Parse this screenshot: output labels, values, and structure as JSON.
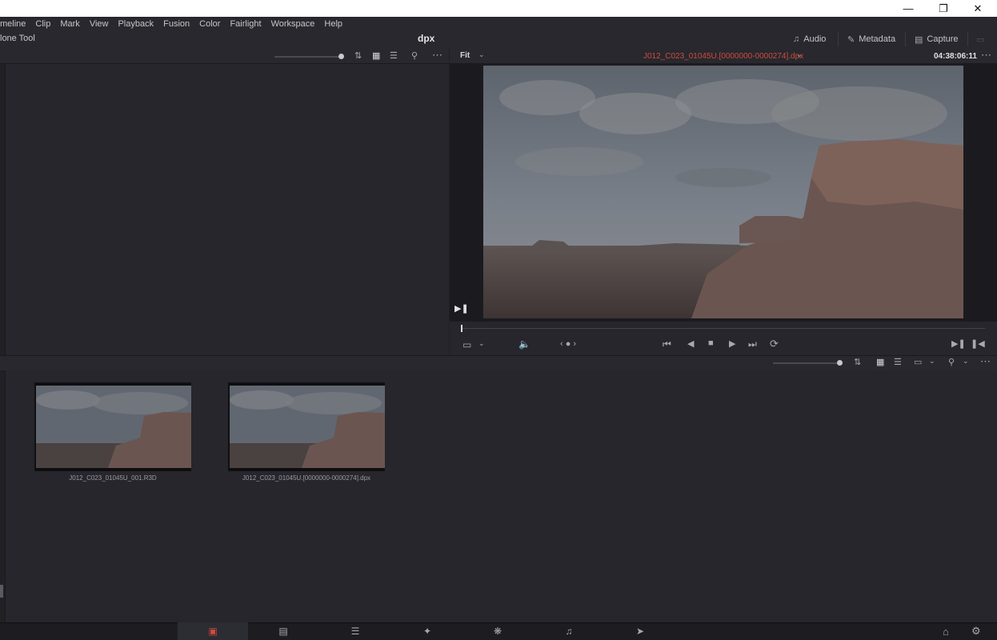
{
  "menubar": {
    "items": [
      "meline",
      "Clip",
      "Mark",
      "View",
      "Playback",
      "Fusion",
      "Color",
      "Fairlight",
      "Workspace",
      "Help"
    ],
    "tool_label": "lone Tool",
    "project_title": "dpx"
  },
  "top_buttons": {
    "audio": "Audio",
    "metadata": "Metadata",
    "capture": "Capture"
  },
  "viewer": {
    "zoom": "Fit",
    "clip_name": "J012_C023_01045U.[0000000-0000274].dpx",
    "timecode": "04:38:06:11"
  },
  "clips": [
    {
      "name": "J012_C023_01045U_001.R3D"
    },
    {
      "name": "J012_C023_01045U.[0000000-0000274].dpx"
    }
  ],
  "colors": {
    "accent_red": "#d04a3c",
    "panel": "#26262c",
    "bar": "#28282e"
  },
  "pages": [
    "media",
    "cut",
    "edit",
    "fusion",
    "color",
    "fairlight",
    "deliver"
  ]
}
